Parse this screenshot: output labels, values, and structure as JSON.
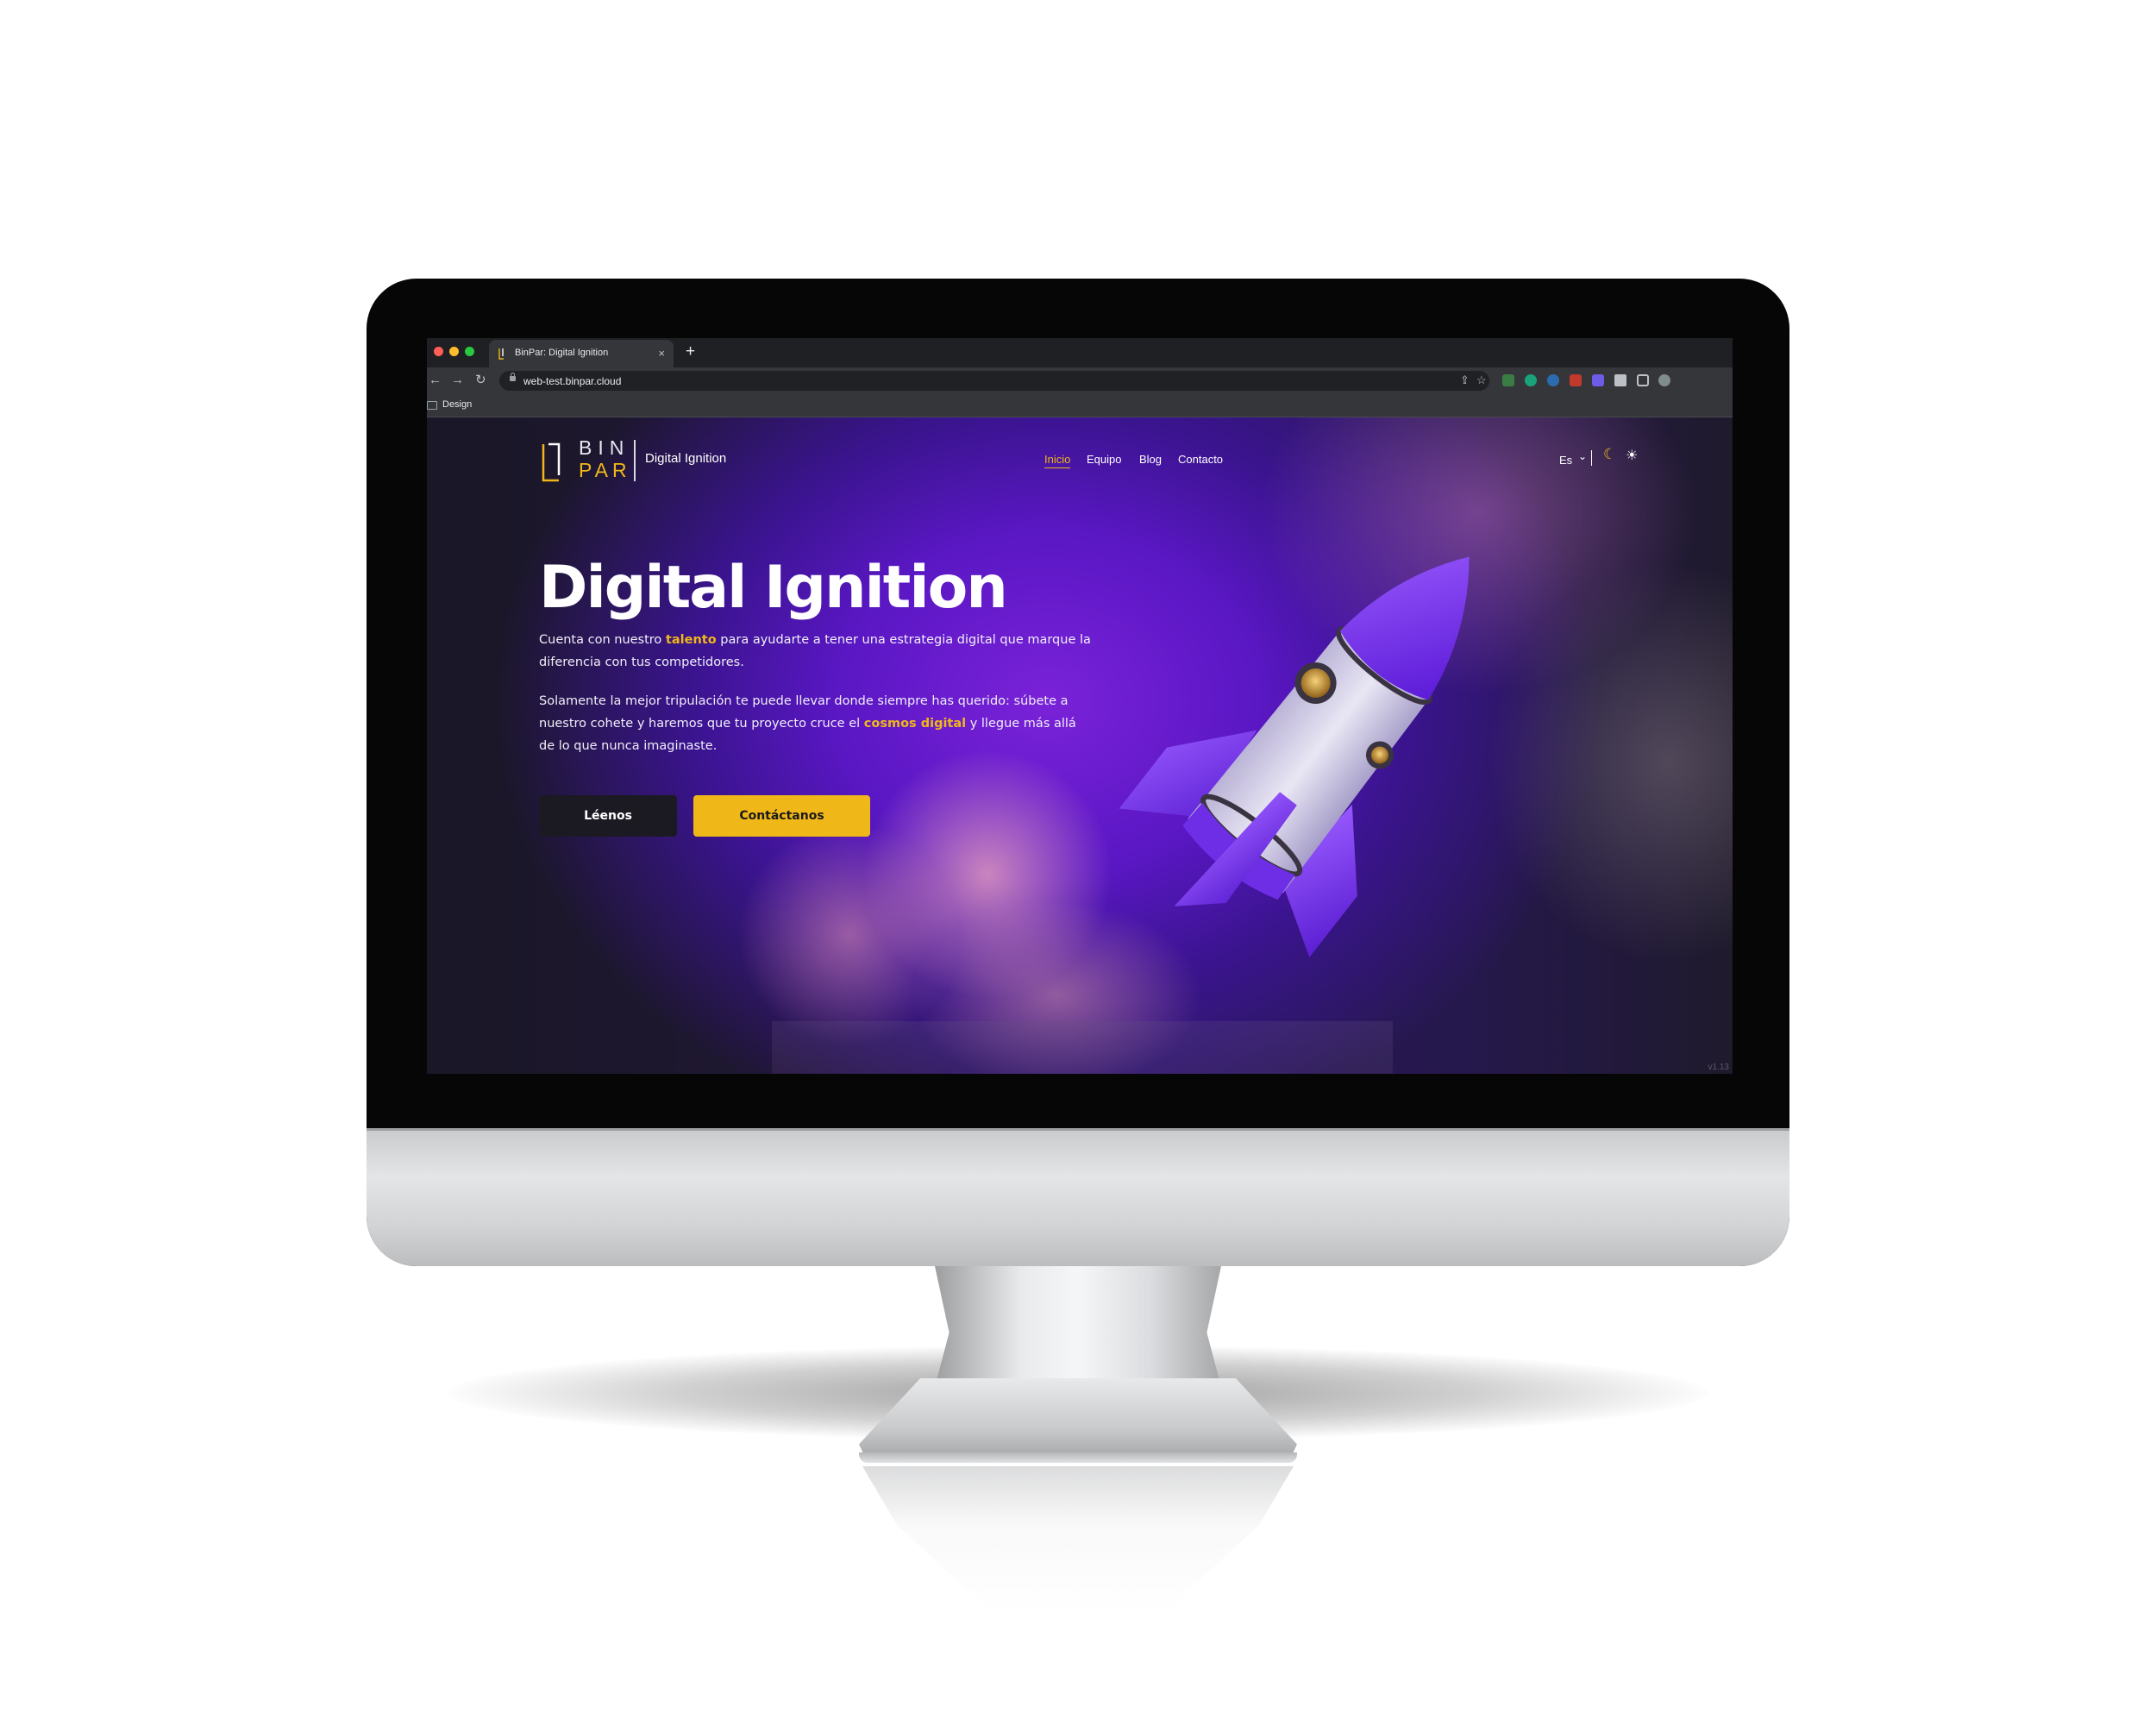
{
  "browser": {
    "tab_title": "BinPar: Digital Ignition",
    "tab_close": "×",
    "new_tab": "+",
    "url": "web-test.binpar.cloud",
    "bookmark": "Design"
  },
  "site": {
    "logo_top": "BIN",
    "logo_bottom": "PAR",
    "tagline": "Digital Ignition",
    "nav": [
      "Inicio",
      "Equipo",
      "Blog",
      "Contacto"
    ],
    "language": "Es",
    "language_chevron": "⌄",
    "theme_dark_icon": "☾",
    "theme_light_icon": "☀"
  },
  "hero": {
    "title": "Digital Ignition",
    "p1_before": "Cuenta con nuestro ",
    "p1_highlight": "talento",
    "p1_after": " para ayudarte a tener una estrategia digital que marque la diferencia con tus competidores.",
    "p2_before": "Solamente la mejor tripulación te puede llevar donde siempre has querido: súbete a nuestro cohete y haremos que tu proyecto cruce el ",
    "p2_highlight": "cosmos digital",
    "p2_after": " y llegue más allá de lo que nunca imaginaste.",
    "button_secondary": "Léenos",
    "button_primary": "Contáctanos"
  },
  "version": "v1.13",
  "colors": {
    "accent": "#f0b719",
    "purple": "#6a1fd0",
    "page_dark": "#1b1a23",
    "browser_chrome": "#35363a"
  }
}
